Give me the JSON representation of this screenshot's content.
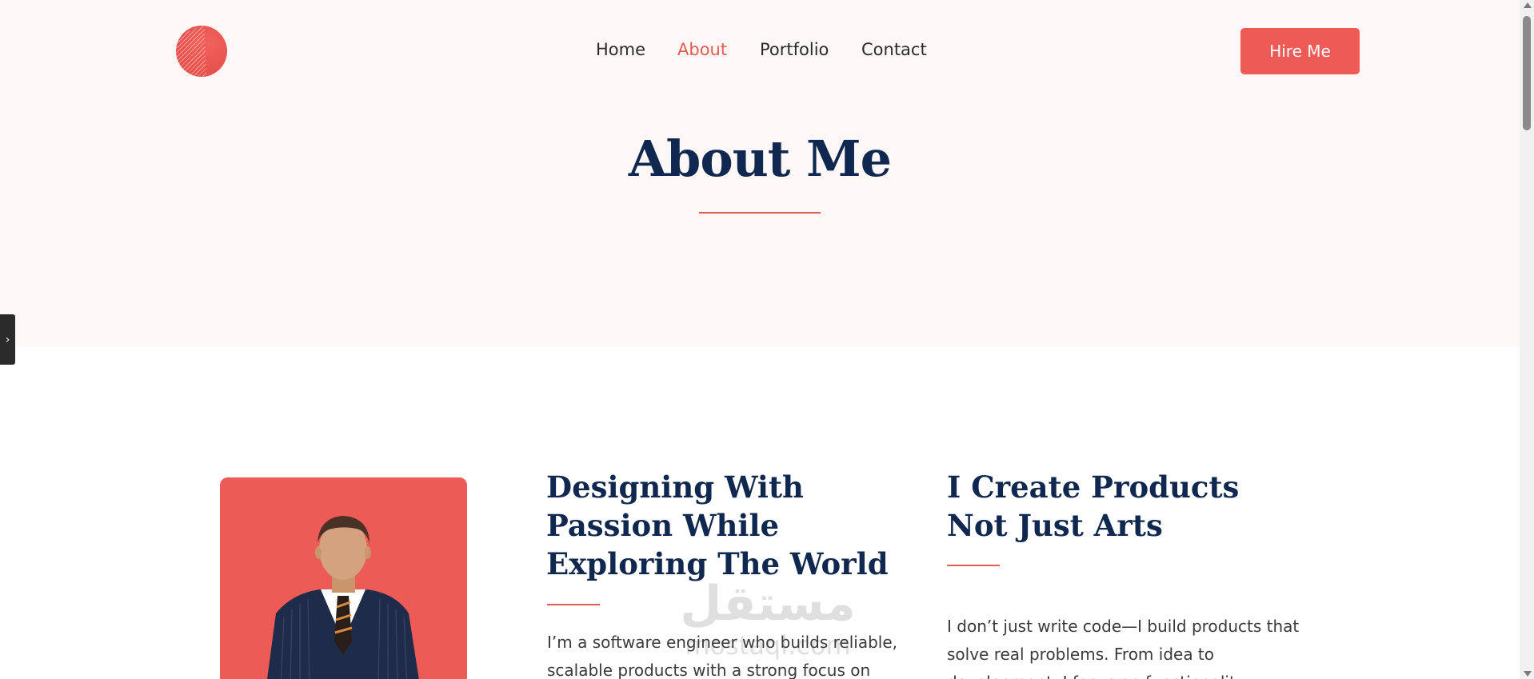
{
  "nav": {
    "items": [
      {
        "label": "Home",
        "active": false
      },
      {
        "label": "About",
        "active": true
      },
      {
        "label": "Portfolio",
        "active": false
      },
      {
        "label": "Contact",
        "active": false
      }
    ],
    "cta_label": "Hire Me"
  },
  "hero": {
    "title": "About Me"
  },
  "about": {
    "left": {
      "heading": "Designing With Passion While Exploring The World",
      "text": "I’m a software engineer who builds reliable, scalable products with a strong focus on"
    },
    "right": {
      "heading": "I Create Products Not Just Arts",
      "text": "I don’t just write code—I build products that solve real problems. From idea to development, I focus on functionality"
    }
  },
  "watermark": {
    "arabic": "مستقل",
    "latin": "mostaql.com"
  },
  "icons": {
    "logo": "circle-logo-icon",
    "side_tab": "chevron-right-icon",
    "portrait": "man-in-suit-illustration"
  },
  "colors": {
    "accent": "#ee5a55",
    "heading": "#10284f",
    "hero_bg": "#fdf8f7"
  }
}
